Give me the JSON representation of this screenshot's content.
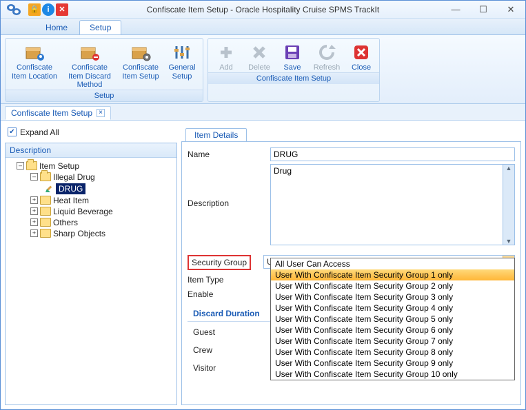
{
  "window": {
    "title": "Confiscate Item Setup - Oracle Hospitality Cruise SPMS TrackIt"
  },
  "tabs": [
    "Home",
    "Setup"
  ],
  "ribbon": {
    "setup": {
      "caption": "Setup",
      "buttons": [
        "Confiscate Item Location",
        "Confiscate Item Discard Method",
        "Confiscate Item Setup",
        "General Setup"
      ]
    },
    "confiscate": {
      "caption": "Confiscate Item Setup",
      "buttons": [
        "Add",
        "Delete",
        "Save",
        "Refresh",
        "Close"
      ]
    }
  },
  "doc_tab": {
    "label": "Confiscate Item Setup"
  },
  "left": {
    "expand_all": "Expand All",
    "header": "Description",
    "tree": {
      "root": "Item Setup",
      "items": [
        {
          "label": "Illegal Drug",
          "children": [
            "DRUG"
          ]
        },
        {
          "label": "Heat Item"
        },
        {
          "label": "Liquid Beverage"
        },
        {
          "label": "Others"
        },
        {
          "label": "Sharp Objects"
        }
      ]
    }
  },
  "details": {
    "tab": "Item Details",
    "labels": {
      "name": "Name",
      "description": "Description",
      "security_group": "Security Group",
      "item_type": "Item Type",
      "enable": "Enable"
    },
    "values": {
      "name": "DRUG",
      "description": "Drug",
      "security_group": "User With Confiscate Item Security Group 1 only"
    },
    "discard": {
      "header": "Discard Duration",
      "rows": [
        "Guest",
        "Crew",
        "Visitor"
      ]
    },
    "security_options": [
      "All User Can Access",
      "User With Confiscate Item Security Group 1 only",
      "User With Confiscate Item Security Group 2 only",
      "User With Confiscate Item Security Group 3 only",
      "User With Confiscate Item Security Group 4 only",
      "User With Confiscate Item Security Group 5 only",
      "User With Confiscate Item Security Group 6 only",
      "User With Confiscate Item Security Group 7 only",
      "User With Confiscate Item Security Group 8 only",
      "User With Confiscate Item Security Group 9 only",
      "User With Confiscate Item Security Group 10 only"
    ]
  }
}
